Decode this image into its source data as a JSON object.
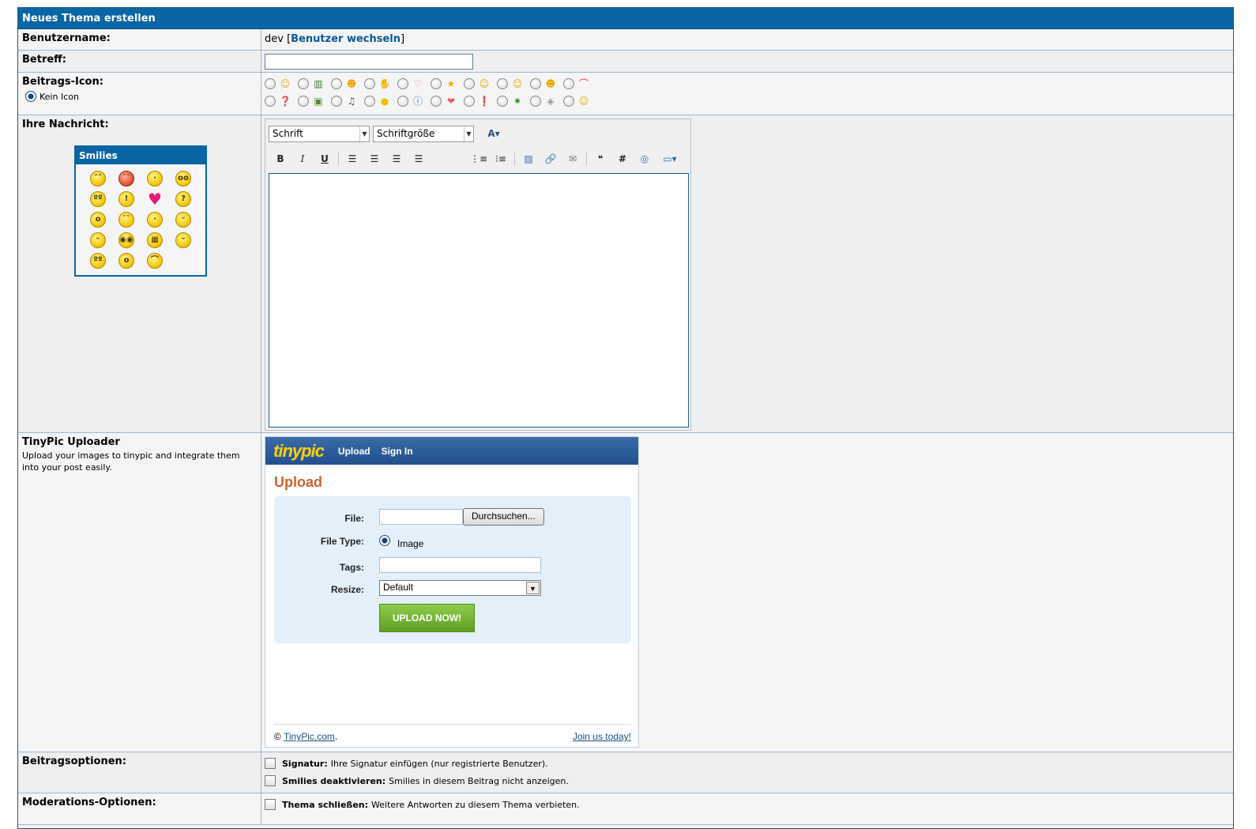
{
  "header": {
    "title": "Neues Thema erstellen"
  },
  "username": {
    "label": "Benutzername:",
    "value": "dev",
    "switch_link": "Benutzer wechseln"
  },
  "subject": {
    "label": "Betreff:",
    "value": ""
  },
  "post_icon": {
    "label": "Beitrags-Icon:",
    "none_label": "Kein Icon",
    "row1": [
      "grin-icon",
      "film-icon",
      "wink-icon",
      "thumbs-icon",
      "heart-outline-icon",
      "star-icon",
      "smile-icon",
      "happy-icon",
      "laugh-icon",
      "rainbow-icon"
    ],
    "row2": [
      "question-icon",
      "picture-icon",
      "music-icon",
      "lightbulb-icon",
      "info-icon",
      "heart-icon",
      "exclamation-icon",
      "bug-icon",
      "cube-icon",
      "blush-icon"
    ]
  },
  "message": {
    "label": "Ihre Nachricht:",
    "font_select": "Schrift",
    "size_select": "Schriftgröße"
  },
  "smilies": {
    "title": "Smilies",
    "items": [
      "angel-smiley",
      "angry-smiley",
      "confused-smiley",
      "cool-smiley",
      "dizzy-smiley",
      "exclamation-smiley",
      "heart-smiley",
      "question-smiley",
      "idea-smiley",
      "shy-smiley",
      "unsure-smiley",
      "smile-smiley",
      "happy-smiley",
      "glasses-smiley",
      "grin-smiley",
      "tongue-smiley",
      "rolleyes-smiley",
      "surprised-smiley",
      "sad-smiley"
    ]
  },
  "tinypic": {
    "label": "TinyPic Uploader",
    "description": "Upload your images to tinypic and integrate them into your post easily.",
    "logo": "tinypic",
    "nav_upload": "Upload",
    "nav_signin": "Sign In",
    "heading": "Upload",
    "file_label": "File:",
    "browse_button": "Durchsuchen...",
    "filetype_label": "File Type:",
    "filetype_value": "Image",
    "tags_label": "Tags:",
    "resize_label": "Resize:",
    "resize_value": "Default",
    "upload_button": "UPLOAD NOW!",
    "footer_copy": "©",
    "footer_link": "TinyPic.com",
    "footer_dot": ".",
    "footer_join": "Join us today!"
  },
  "post_options": {
    "label": "Beitragsoptionen:",
    "signature_bold": "Signatur:",
    "signature_text": "Ihre Signatur einfügen (nur registrierte Benutzer).",
    "smilies_bold": "Smilies deaktivieren:",
    "smilies_text": "Smilies in diesem Beitrag nicht anzeigen."
  },
  "mod_options": {
    "label": "Moderations-Optionen:",
    "close_bold": "Thema schließen:",
    "close_text": "Weitere Antworten zu diesem Thema verbieten."
  }
}
